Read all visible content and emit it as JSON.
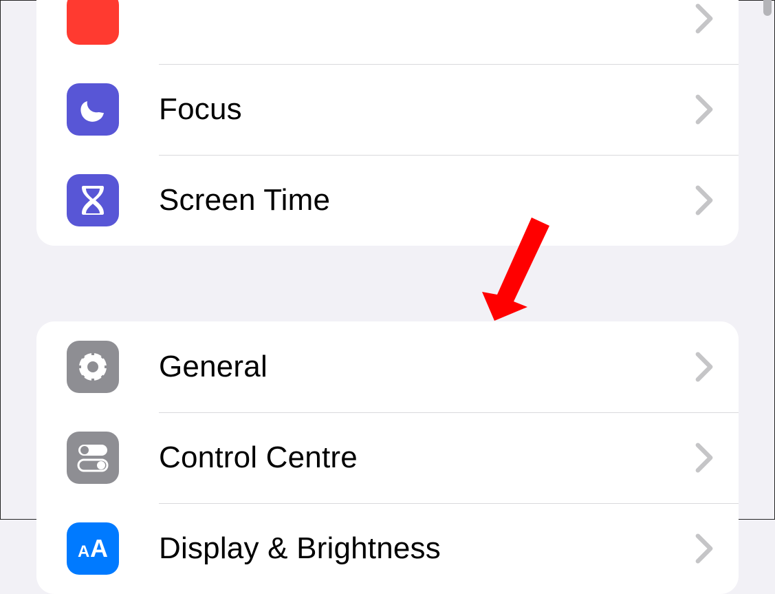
{
  "groups": [
    {
      "id": "focus-group",
      "items": [
        {
          "id": "unknown-top",
          "label": "",
          "icon": "red-blank-icon",
          "tile": "c-red"
        },
        {
          "id": "focus",
          "label": "Focus",
          "icon": "moon-icon",
          "tile": "c-indigo"
        },
        {
          "id": "screen-time",
          "label": "Screen Time",
          "icon": "hourglass-icon",
          "tile": "c-indigo"
        }
      ]
    },
    {
      "id": "general-group",
      "items": [
        {
          "id": "general",
          "label": "General",
          "icon": "gear-icon",
          "tile": "c-gray"
        },
        {
          "id": "control-centre",
          "label": "Control Centre",
          "icon": "toggles-icon",
          "tile": "c-gray"
        },
        {
          "id": "display",
          "label": "Display & Brightness",
          "icon": "text-size-icon",
          "tile": "c-blue"
        }
      ]
    }
  ],
  "annotation_arrow_color": "#ff0000"
}
